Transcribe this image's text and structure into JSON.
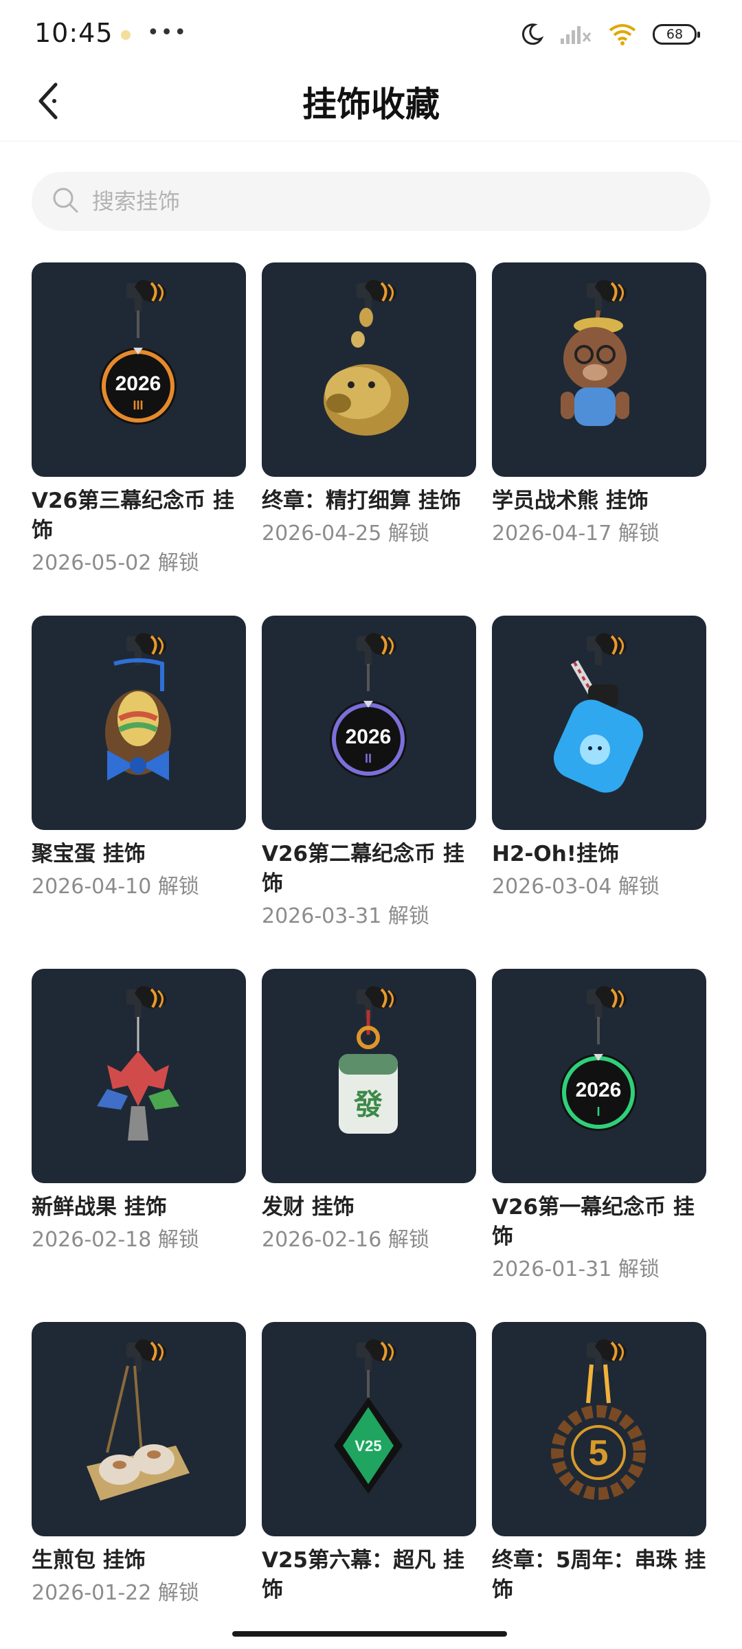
{
  "status_bar": {
    "time": "10:45",
    "more": "•••",
    "battery": "68",
    "icons": [
      "moon-icon",
      "signal-icon",
      "wifi-icon",
      "battery-icon"
    ]
  },
  "header": {
    "title": "挂饰收藏",
    "back_icon": "chevron-left-icon"
  },
  "search": {
    "placeholder": "搜索挂饰",
    "value": ""
  },
  "items": [
    {
      "name": "V26第三幕纪念币 挂饰",
      "date": "2026-05-02 解锁",
      "icon": "medallion-icon",
      "badge": "2026",
      "sub": "III",
      "accent": "#e58a2c"
    },
    {
      "name": "终章：精打细算 挂饰",
      "date": "2026-04-25 解锁",
      "icon": "piggy-bank-icon",
      "accent": "#c9a24a"
    },
    {
      "name": "学员战术熊 挂饰",
      "date": "2026-04-17 解锁",
      "icon": "bear-icon",
      "accent": "#8b5a3c"
    },
    {
      "name": "聚宝蛋 挂饰",
      "date": "2026-04-10 解锁",
      "icon": "egg-basket-icon",
      "accent": "#2f6fd6"
    },
    {
      "name": "V26第二幕纪念币 挂饰",
      "date": "2026-03-31 解锁",
      "icon": "medallion-icon",
      "badge": "2026",
      "sub": "II",
      "accent": "#7b6fd9"
    },
    {
      "name": "H2-Oh!挂饰",
      "date": "2026-03-04 解锁",
      "icon": "water-bottle-icon",
      "accent": "#2fa8f0"
    },
    {
      "name": "新鲜战果 挂饰",
      "date": "2026-02-18 解锁",
      "icon": "fruit-tree-icon",
      "accent": "#d24b4b"
    },
    {
      "name": "发财 挂饰",
      "date": "2026-02-16 解锁",
      "icon": "mahjong-tile-icon",
      "badge": "發",
      "accent": "#3c8a4a"
    },
    {
      "name": "V26第一幕纪念币 挂饰",
      "date": "2026-01-31 解锁",
      "icon": "medallion-icon",
      "badge": "2026",
      "sub": "I",
      "accent": "#2fd07a"
    },
    {
      "name": "生煎包 挂饰",
      "date": "2026-01-22 解锁",
      "icon": "dumplings-icon",
      "accent": "#c8a86a"
    },
    {
      "name": "V25第六幕：超凡 挂饰",
      "date": "",
      "icon": "emerald-icon",
      "badge": "V25",
      "accent": "#1fa560"
    },
    {
      "name": "终章：5周年：串珠 挂饰",
      "date": "",
      "icon": "bead-ring-icon",
      "badge": "5",
      "accent": "#d99a2b"
    }
  ]
}
